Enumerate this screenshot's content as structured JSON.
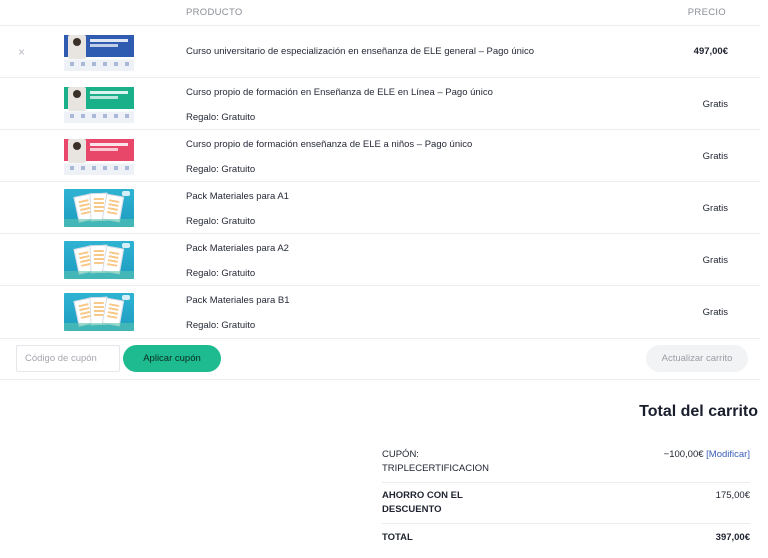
{
  "table": {
    "col_product": "PRODUCTO",
    "col_price": "PRECIO"
  },
  "items": [
    {
      "name": "Curso universitario de especialización en enseñanza de ELE general – Pago único",
      "gift": "",
      "price": "497,00€",
      "thumb_color": "#2f5bb0",
      "removable": true
    },
    {
      "name": "Curso propio de formación en Enseñanza de ELE en Línea – Pago único",
      "gift": "Regalo: Gratuito",
      "price": "Gratis",
      "thumb_color": "#1ab08a"
    },
    {
      "name": "Curso propio de formación enseñanza de ELE a niños – Pago único",
      "gift": "Regalo: Gratuito",
      "price": "Gratis",
      "thumb_color": "#e8476a"
    },
    {
      "name": "Pack Materiales para A1",
      "gift": "Regalo: Gratuito",
      "price": "Gratis"
    },
    {
      "name": "Pack Materiales para A2",
      "gift": "Regalo: Gratuito",
      "price": "Gratis"
    },
    {
      "name": "Pack Materiales para B1",
      "gift": "Regalo: Gratuito",
      "price": "Gratis"
    }
  ],
  "remove_icon": "×",
  "coupon": {
    "placeholder": "Código de cupón",
    "apply_label": "Aplicar cupón",
    "update_label": "Actualizar carrito"
  },
  "totals": {
    "title": "Total del carrito",
    "coupon_label": "CUPÓN: TRIPLECERTIFICACION",
    "coupon_value": "−100,00€",
    "coupon_modify": "[Modificar]",
    "savings_label": "AHORRO CON EL DESCUENTO",
    "savings_value": "175,00€",
    "total_label": "TOTAL",
    "total_value": "397,00€"
  },
  "colors": {
    "accent": "#1dbb8f",
    "link": "#3a5fb8"
  }
}
